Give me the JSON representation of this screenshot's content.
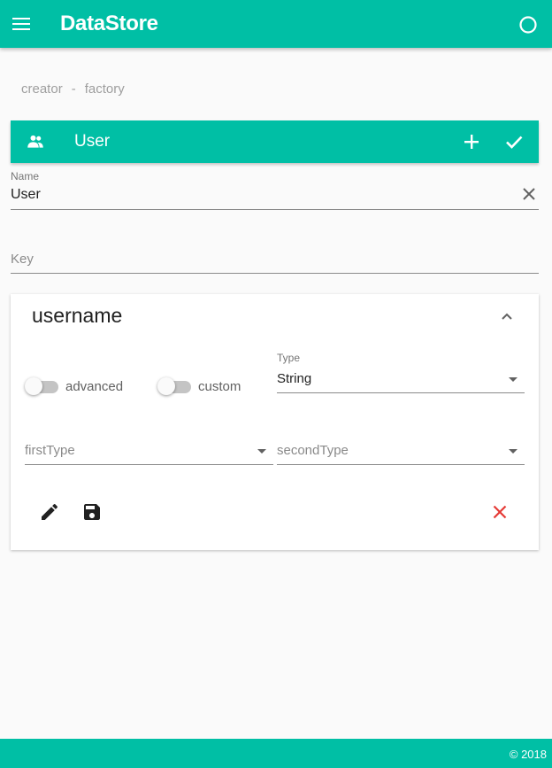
{
  "app": {
    "title": "DataStore"
  },
  "breadcrumb": {
    "items": [
      "creator",
      "factory"
    ],
    "separator": "-"
  },
  "toolbar": {
    "title": "User"
  },
  "name_field": {
    "label": "Name",
    "value": "User"
  },
  "key_field": {
    "placeholder": "Key"
  },
  "attribute_card": {
    "title": "username",
    "switches": [
      {
        "label": "advanced",
        "checked": false
      },
      {
        "label": "custom",
        "checked": false
      }
    ],
    "type_select": {
      "label": "Type",
      "value": "String"
    },
    "first_type_select": {
      "placeholder": "firstType"
    },
    "second_type_select": {
      "placeholder": "secondType"
    }
  },
  "footer": {
    "text": "© 2018"
  },
  "colors": {
    "primary": "#00bfa5",
    "danger": "#e53935",
    "background": "#fafafa"
  },
  "icons": [
    "menu-icon",
    "circle-status-icon",
    "group-icon",
    "add-icon",
    "check-icon",
    "clear-icon",
    "chevron-up-icon",
    "edit-icon",
    "save-icon",
    "close-icon"
  ]
}
